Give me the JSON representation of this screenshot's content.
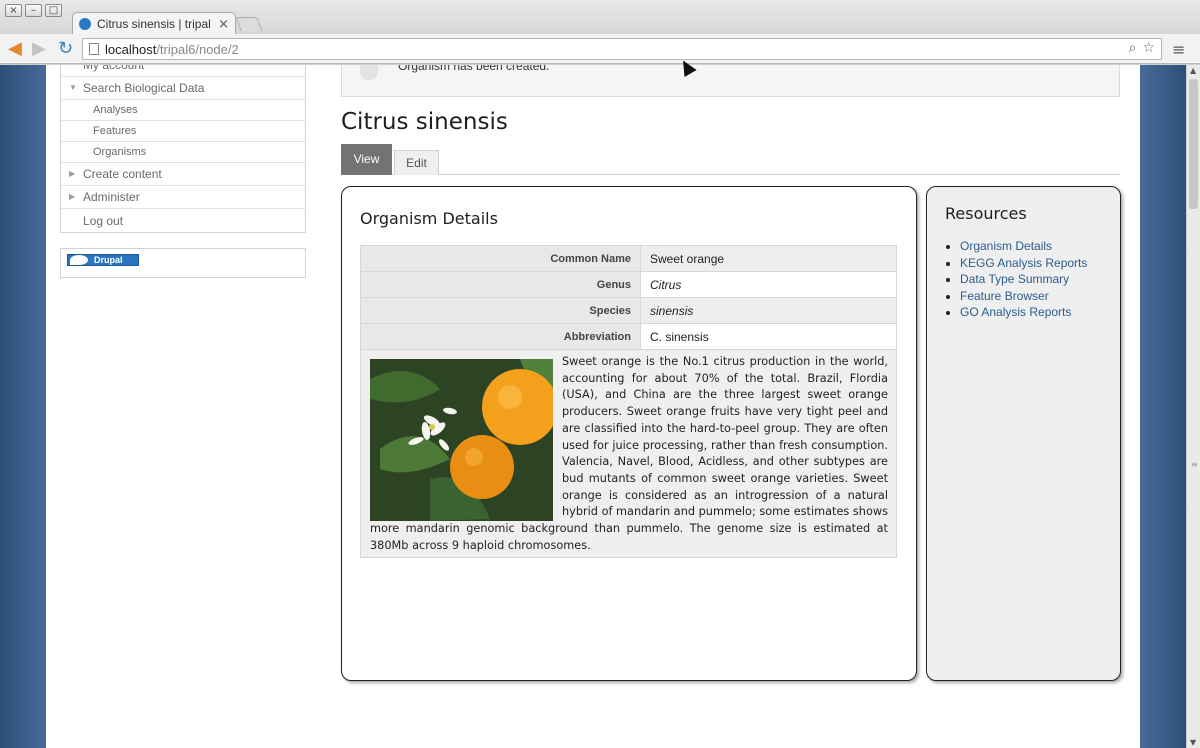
{
  "browser": {
    "tab_title": "Citrus sinensis | tripal v",
    "tab_close": "×",
    "url_host": "localhost",
    "url_path": "/tripal6/node/2",
    "window_buttons": [
      "×",
      "–",
      "□"
    ]
  },
  "sidebar": {
    "items": [
      {
        "label": "My account",
        "arrow": ""
      },
      {
        "label": "Search Biological Data",
        "arrow": "▼"
      },
      {
        "label": "Analyses",
        "arrow": ""
      },
      {
        "label": "Features",
        "arrow": ""
      },
      {
        "label": "Organisms",
        "arrow": ""
      },
      {
        "label": "Create content",
        "arrow": "▶"
      },
      {
        "label": "Administer",
        "arrow": "▶"
      },
      {
        "label": "Log out",
        "arrow": ""
      }
    ],
    "drupal_badge": "Drupal"
  },
  "message": {
    "text": "Organism has been created."
  },
  "page": {
    "title": "Citrus sinensis",
    "tabs": [
      {
        "label": "View",
        "active": true
      },
      {
        "label": "Edit",
        "active": false
      }
    ]
  },
  "details": {
    "title": "Organism Details",
    "rows": [
      {
        "label": "Common Name",
        "value": "Sweet orange"
      },
      {
        "label": "Genus",
        "value": "Citrus"
      },
      {
        "label": "Species",
        "value": "sinensis"
      },
      {
        "label": "Abbreviation",
        "value": "C. sinensis"
      }
    ],
    "description": "Sweet orange is the No.1 citrus production in the world, accounting for about 70% of the total. Brazil, Flordia (USA), and China are the three largest sweet orange producers. Sweet orange fruits have very tight peel and are classified into the hard-to-peel group. They are often used for juice processing, rather than fresh consumption. Valencia, Navel, Blood, Acidless, and other subtypes are bud mutants of common sweet orange varieties. Sweet orange is considered as an introgression of a natural hybrid of mandarin and pummelo; some estimates shows more mandarin genomic background than pummelo. The genome size is estimated at 380Mb across 9 haploid chromosomes."
  },
  "resources": {
    "title": "Resources",
    "links": [
      "Organism Details",
      "KEGG Analysis Reports",
      "Data Type Summary",
      "Feature Browser",
      "GO Analysis Reports"
    ]
  },
  "colors": {
    "link": "#2c5c8f",
    "active_tab": "#737373",
    "page_frame": "#466b99"
  }
}
